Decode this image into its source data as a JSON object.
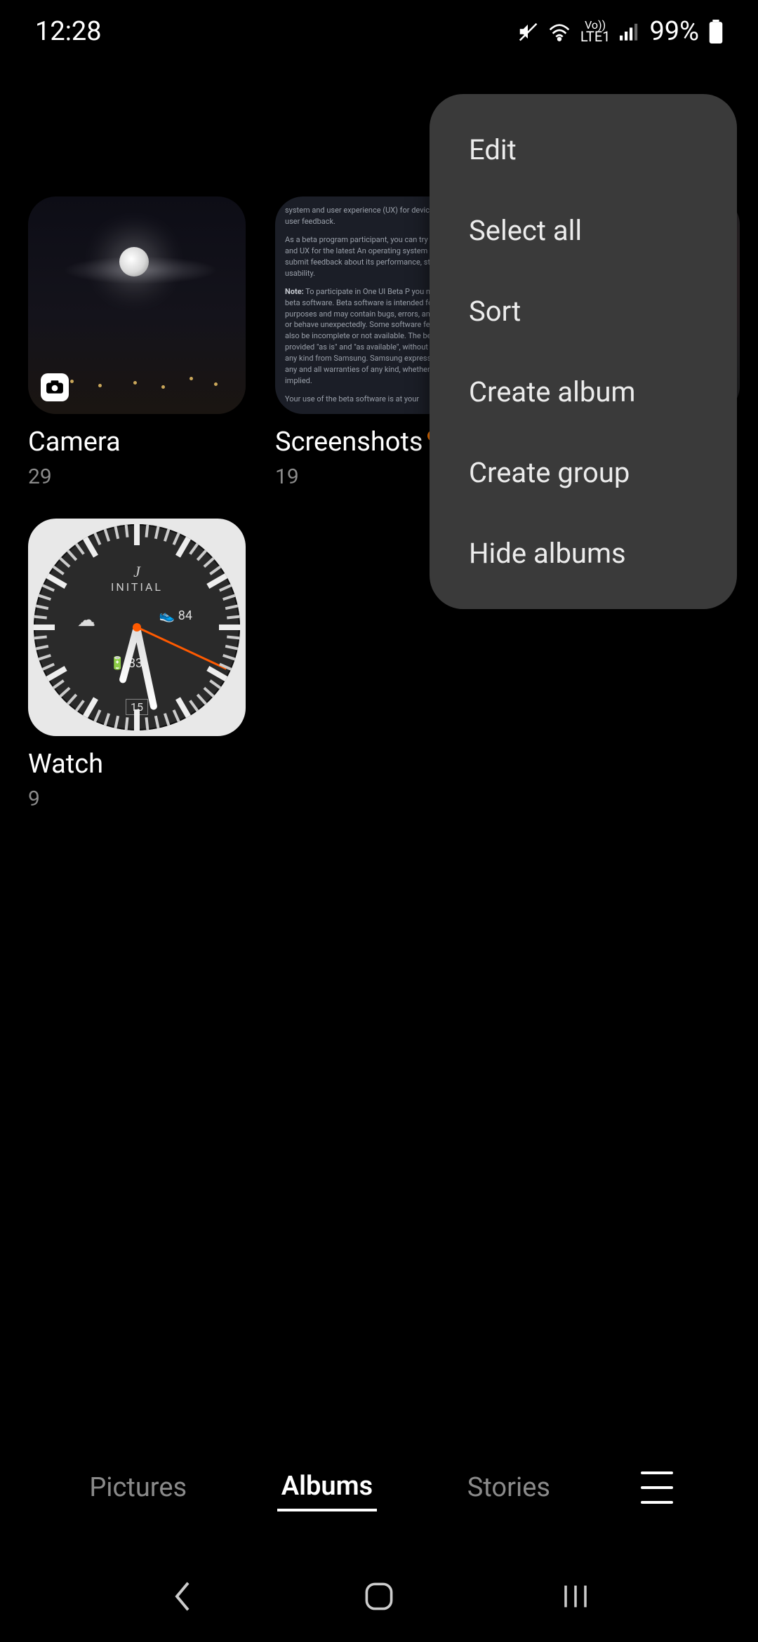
{
  "status": {
    "time": "12:28",
    "battery_text": "99%",
    "network_label": "LTE1",
    "volte_label": "Vo))"
  },
  "albums": [
    {
      "title": "Camera",
      "count": "29",
      "has_new": false
    },
    {
      "title": "Screenshots",
      "count": "19",
      "has_new": true
    },
    {
      "title": "",
      "count": "",
      "has_new": false
    },
    {
      "title": "Watch",
      "count": "9",
      "has_new": false
    }
  ],
  "watch": {
    "brand_letter": "J",
    "brand_word": "INITIAL",
    "steps": "84",
    "battery": "83",
    "date": "15"
  },
  "screenshot_preview": {
    "line1": "system and user experience (UX) for devices, based on user feedback.",
    "line2": "As a beta program participant, you can try new features and UX for the latest An operating system version, and submit feedback about its performance, stability, usability.",
    "note_label": "Note:",
    "line3": "To participate in One UI Beta P you need to install beta software. Beta software is intended for testing purposes and may contain bugs, errors, and instabilities or behave unexpectedly. Some software features may also be incomplete or not available. The beta software is provided \"as is\" and \"as available\", without any warranty of any kind from Samsung. Samsung expressly disclaims any and all warranties of any kind, whether express or implied.",
    "line4": "Your use of the beta software is at your"
  },
  "menu": {
    "items": [
      "Edit",
      "Select all",
      "Sort",
      "Create album",
      "Create group",
      "Hide albums"
    ]
  },
  "tabs": {
    "pictures": "Pictures",
    "albums": "Albums",
    "stories": "Stories"
  }
}
